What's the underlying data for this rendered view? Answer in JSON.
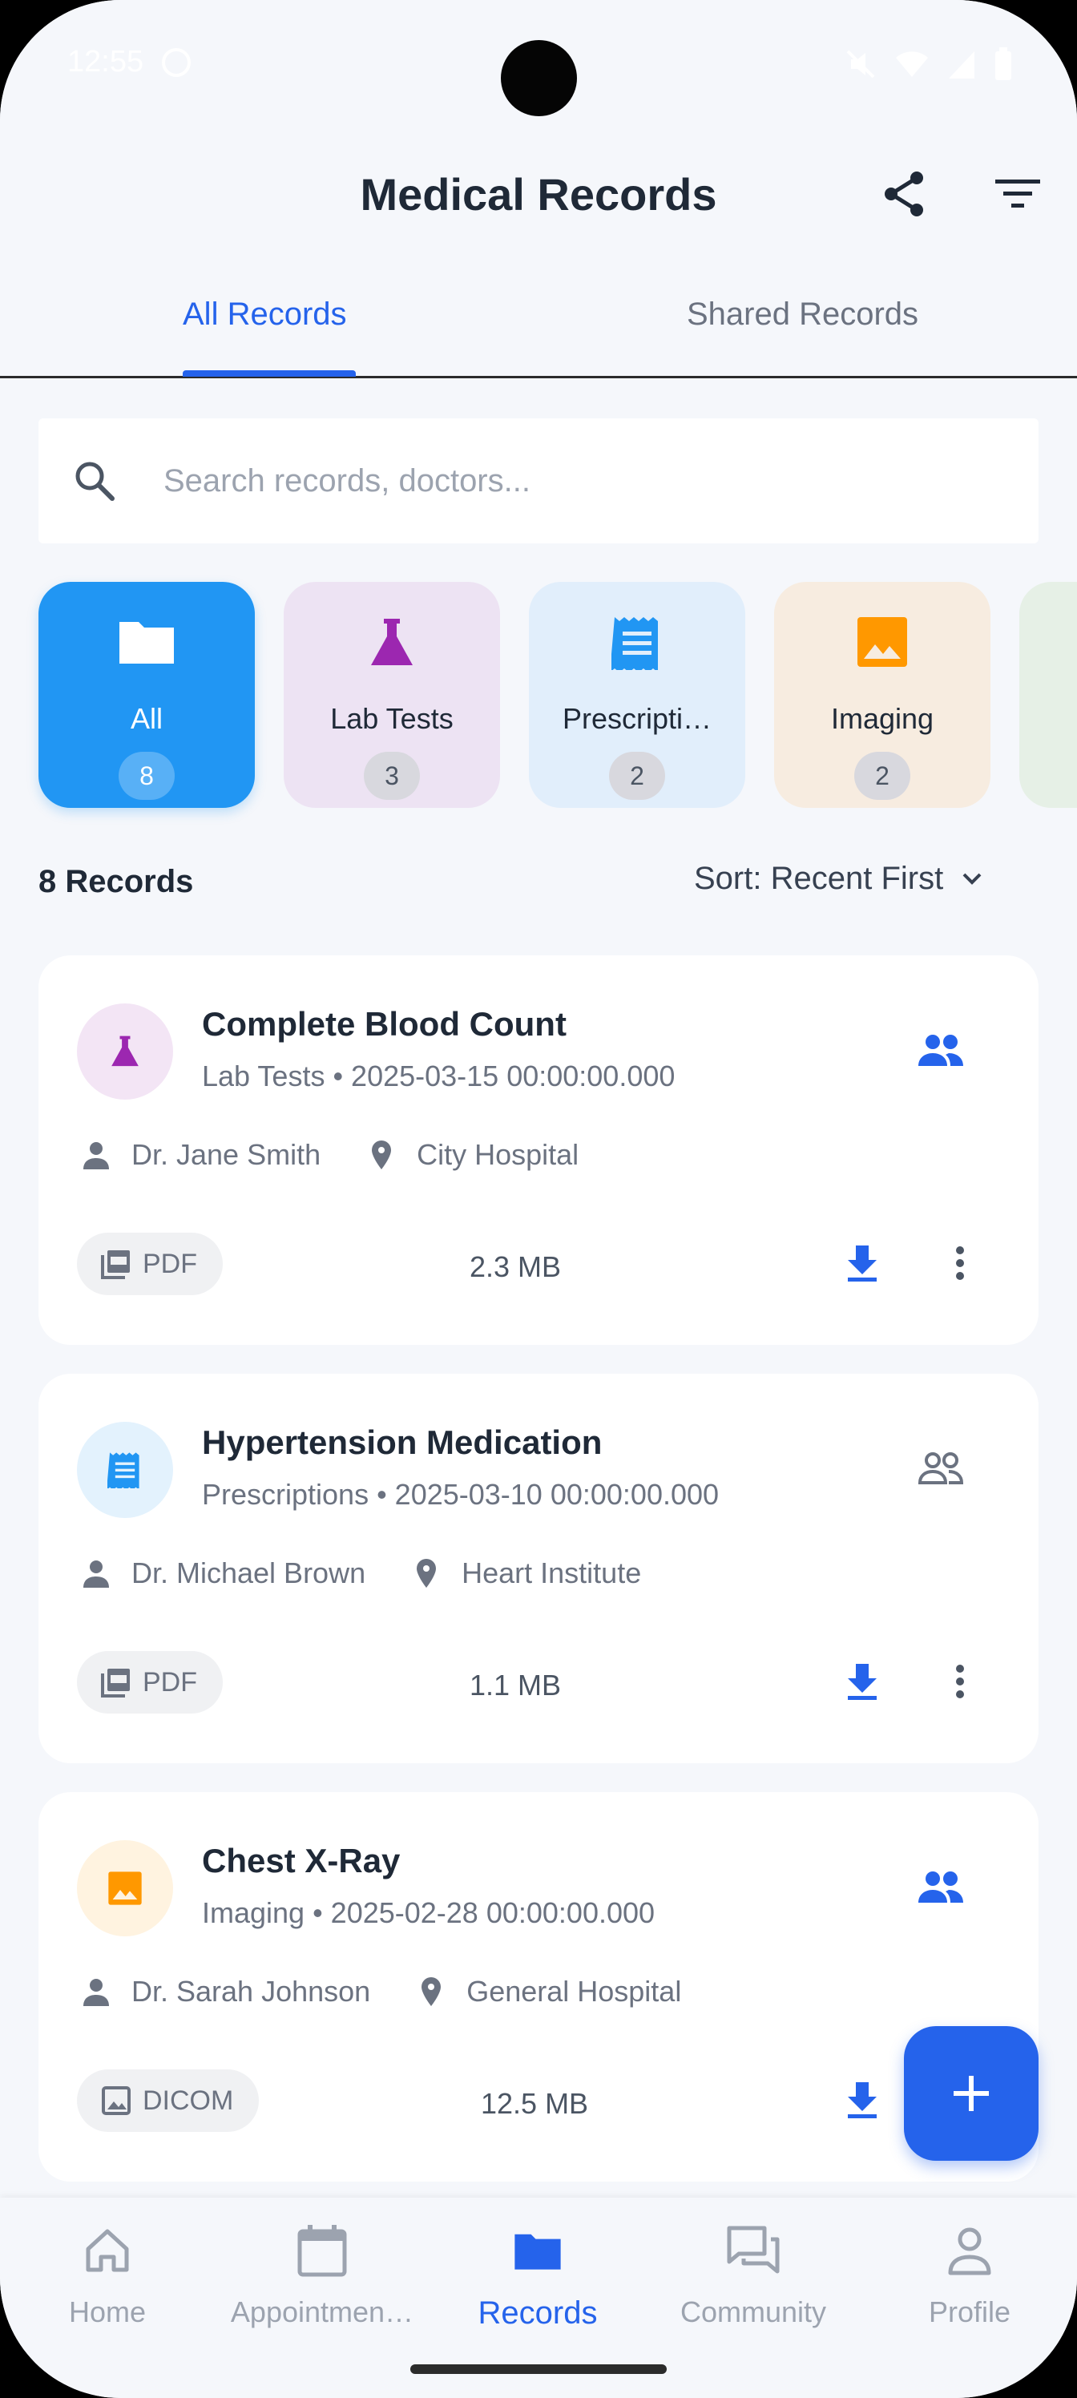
{
  "status_bar": {
    "time": "12:55"
  },
  "header": {
    "title": "Medical Records",
    "share_icon": "share-icon",
    "filter_icon": "filter-icon"
  },
  "tabs": [
    {
      "label": "All Records",
      "active": true
    },
    {
      "label": "Shared Records",
      "active": false
    }
  ],
  "search": {
    "placeholder": "Search records, doctors...",
    "value": ""
  },
  "categories": [
    {
      "label": "All",
      "count": "8",
      "icon": "folder-icon",
      "selected": true
    },
    {
      "label": "Lab Tests",
      "count": "3",
      "icon": "flask-icon",
      "selected": false
    },
    {
      "label": "Prescripti…",
      "count": "2",
      "icon": "receipt-icon",
      "selected": false
    },
    {
      "label": "Imaging",
      "count": "2",
      "icon": "image-icon",
      "selected": false
    }
  ],
  "list_header": {
    "count_label": "8 Records",
    "sort_label": "Sort: Recent First"
  },
  "records": [
    {
      "title": "Complete Blood Count",
      "subtitle": "Lab Tests • 2025-03-15 00:00:00.000",
      "doctor": "Dr. Jane Smith",
      "location": "City Hospital",
      "file_type": "PDF",
      "size": "2.3 MB",
      "shared": true,
      "accent": "#9C27B0"
    },
    {
      "title": "Hypertension Medication",
      "subtitle": "Prescriptions • 2025-03-10 00:00:00.000",
      "doctor": "Dr. Michael Brown",
      "location": "Heart Institute",
      "file_type": "PDF",
      "size": "1.1 MB",
      "shared": false,
      "accent": "#2196F3"
    },
    {
      "title": "Chest X-Ray",
      "subtitle": "Imaging • 2025-02-28 00:00:00.000",
      "doctor": "Dr. Sarah Johnson",
      "location": "General Hospital",
      "file_type": "DICOM",
      "size": "12.5 MB",
      "shared": true,
      "accent": "#FF9800"
    }
  ],
  "fab": {
    "icon": "plus-icon"
  },
  "bottom_nav": [
    {
      "label": "Home",
      "icon": "home-icon",
      "active": false
    },
    {
      "label": "Appointmen…",
      "icon": "calendar-icon",
      "active": false
    },
    {
      "label": "Records",
      "icon": "folder-icon",
      "active": true
    },
    {
      "label": "Community",
      "icon": "forum-icon",
      "active": false
    },
    {
      "label": "Profile",
      "icon": "person-icon",
      "active": false
    }
  ],
  "colors": {
    "primary": "#2563EB",
    "accent_blue": "#2196F3",
    "background": "#F5F7FB",
    "lab": "#9C27B0",
    "imaging": "#FF9800"
  }
}
